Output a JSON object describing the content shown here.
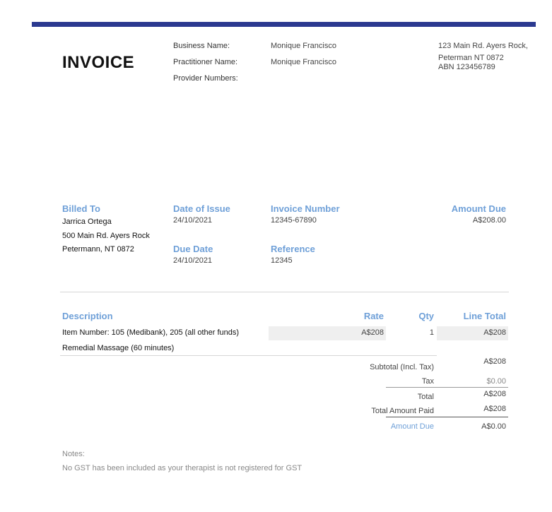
{
  "invoice": {
    "title": "INVOICE",
    "business_name_label": "Business Name:",
    "business_name": "Monique Francisco",
    "practitioner_name_label": "Practitioner Name:",
    "practitioner_name": "Monique Francisco",
    "provider_numbers_label": "Provider Numbers:",
    "address_line1": "123 Main Rd. Ayers Rock,",
    "address_line2": "Peterman NT 0872",
    "abn": "ABN 123456789"
  },
  "billing": {
    "billed_to_label": "Billed To",
    "billed_to_name": "Jarrica Ortega",
    "billed_to_address1": "500 Main Rd. Ayers Rock",
    "billed_to_address2": "Petermann, NT 0872",
    "date_of_issue_label": "Date of Issue",
    "date_of_issue": "24/10/2021",
    "due_date_label": "Due Date",
    "due_date": "24/10/2021",
    "invoice_number_label": "Invoice Number",
    "invoice_number": "12345-67890",
    "reference_label": "Reference",
    "reference": "12345",
    "amount_due_label": "Amount Due",
    "amount_due": "A$208.00"
  },
  "line_items": {
    "headers": {
      "description": "Description",
      "rate": "Rate",
      "qty": "Qty",
      "line_total": "Line Total"
    },
    "rows": [
      {
        "description_line1": "Item Number: 105 (Medibank), 205 (all other funds)",
        "description_line2": "Remedial Massage (60 minutes)",
        "rate": "A$208",
        "qty": "1",
        "line_total": "A$208"
      }
    ]
  },
  "totals": {
    "subtotal_label": "Subtotal (Incl. Tax)",
    "subtotal": "A$208",
    "tax_label": "Tax",
    "tax": "$0.00",
    "total_label": "Total",
    "total": "A$208",
    "total_paid_label": "Total Amount Paid",
    "total_paid": "A$208",
    "amount_due_label": "Amount Due",
    "amount_due": "A$0.00"
  },
  "notes": {
    "label": "Notes:",
    "text": "No GST has been included as your therapist is not registered for GST"
  }
}
